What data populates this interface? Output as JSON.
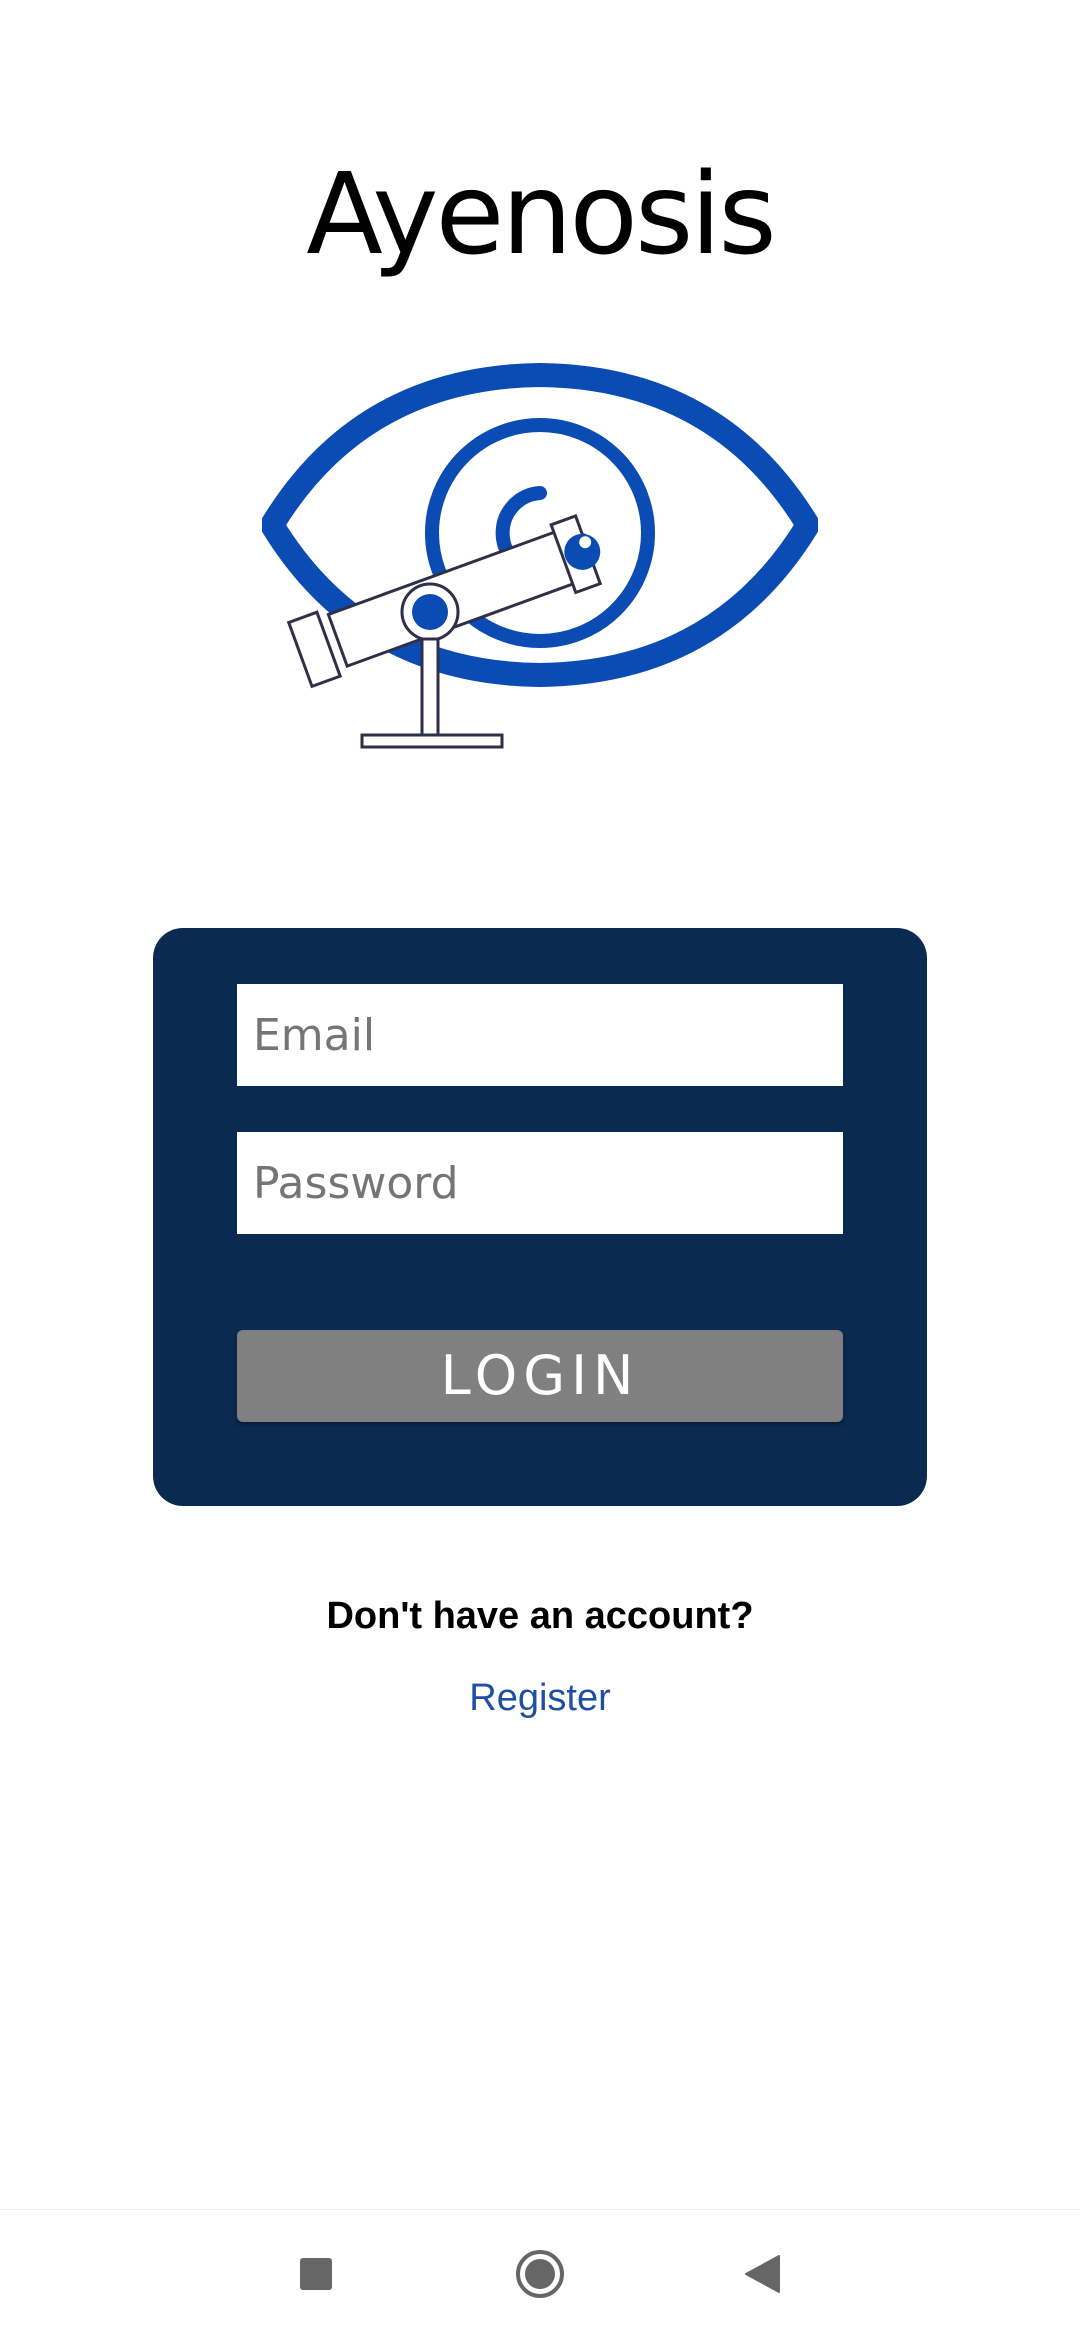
{
  "app": {
    "title": "Ayenosis"
  },
  "login_form": {
    "email_placeholder": "Email",
    "email_value": "",
    "password_placeholder": "Password",
    "password_value": "",
    "login_label": "LOGIN"
  },
  "signup": {
    "prompt": "Don't have an account?",
    "register_label": "Register"
  },
  "navigation": {
    "recents_icon": "square-icon",
    "home_icon": "circle-icon",
    "back_icon": "triangle-back-icon"
  },
  "colors": {
    "card_background": "#0b2a52",
    "logo_blue": "#0a4bb4",
    "button_gray": "#808080",
    "link_blue": "#1f4fa3",
    "telescope_outline": "#2f2f48",
    "nav_icon": "#666666"
  }
}
